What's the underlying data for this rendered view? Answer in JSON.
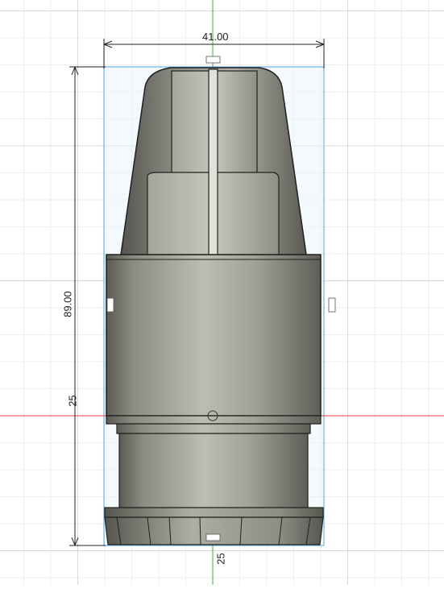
{
  "dimensions": {
    "width_label": "41.00",
    "height_label": "89.00",
    "axis_label_left": "25",
    "axis_label_bottom": "25"
  },
  "colors": {
    "grid_minor": "#ededed",
    "grid_major": "#d9d9d9",
    "x_axis": "#e04040",
    "y_axis": "#40b040",
    "selection_box_fill": "#eaf4fb",
    "selection_box_stroke": "#6fb6e6",
    "body_light": "#b9b9ad",
    "body_dark": "#5b5b54",
    "edge": "#202020"
  }
}
